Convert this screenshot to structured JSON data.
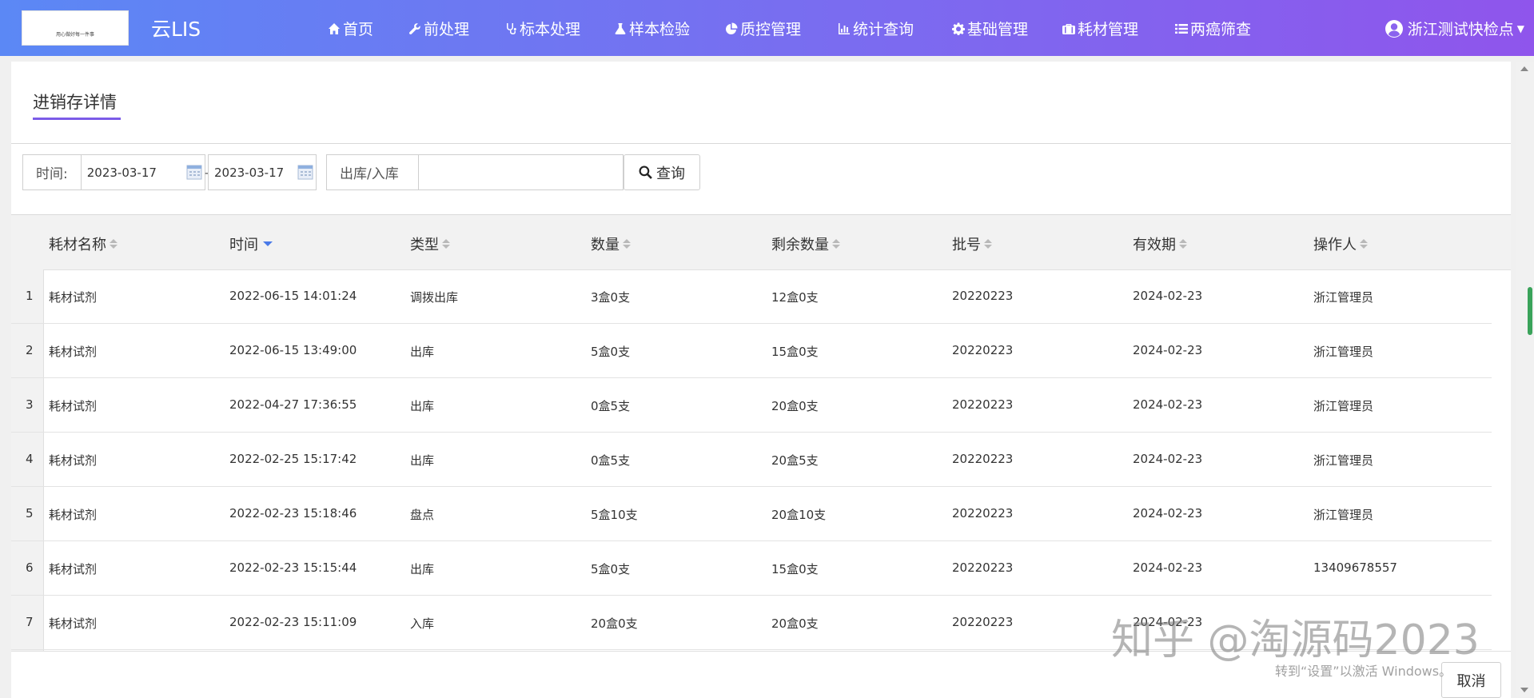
{
  "navbar": {
    "logo_text": "用心做好每一件事",
    "app_title": "云LIS",
    "items": [
      {
        "label": "首页",
        "icon": "home-icon"
      },
      {
        "label": "前处理",
        "icon": "wrench-icon"
      },
      {
        "label": "标本处理",
        "icon": "stethoscope-icon"
      },
      {
        "label": "样本检验",
        "icon": "flask-icon"
      },
      {
        "label": "质控管理",
        "icon": "pie-chart-icon"
      },
      {
        "label": "统计查询",
        "icon": "bar-chart-icon"
      },
      {
        "label": "基础管理",
        "icon": "gear-icon"
      },
      {
        "label": "耗材管理",
        "icon": "briefcase-icon"
      },
      {
        "label": "两癌筛查",
        "icon": "list-icon"
      }
    ],
    "user": "浙江测试快检点"
  },
  "page": {
    "title": "进销存详情"
  },
  "filters": {
    "time_label": "时间:",
    "date_from": "2023-03-17",
    "date_separator": "-",
    "date_to": "2023-03-17",
    "type_label": "出库/入库",
    "type_value": "",
    "query_button": "查询"
  },
  "table": {
    "columns": [
      "耗材名称",
      "时间",
      "类型",
      "数量",
      "剩余数量",
      "批号",
      "有效期",
      "操作人"
    ],
    "rows": [
      {
        "no": "1",
        "name": "耗材试剂",
        "time": "2022-06-15 14:01:24",
        "type": "调拨出库",
        "qty": "3盒0支",
        "remain": "12盒0支",
        "batch": "20220223",
        "expiry": "2024-02-23",
        "operator": "浙江管理员"
      },
      {
        "no": "2",
        "name": "耗材试剂",
        "time": "2022-06-15 13:49:00",
        "type": "出库",
        "qty": "5盒0支",
        "remain": "15盒0支",
        "batch": "20220223",
        "expiry": "2024-02-23",
        "operator": "浙江管理员"
      },
      {
        "no": "3",
        "name": "耗材试剂",
        "time": "2022-04-27 17:36:55",
        "type": "出库",
        "qty": "0盒5支",
        "remain": "20盒0支",
        "batch": "20220223",
        "expiry": "2024-02-23",
        "operator": "浙江管理员"
      },
      {
        "no": "4",
        "name": "耗材试剂",
        "time": "2022-02-25 15:17:42",
        "type": "出库",
        "qty": "0盒5支",
        "remain": "20盒5支",
        "batch": "20220223",
        "expiry": "2024-02-23",
        "operator": "浙江管理员"
      },
      {
        "no": "5",
        "name": "耗材试剂",
        "time": "2022-02-23 15:18:46",
        "type": "盘点",
        "qty": "5盒10支",
        "remain": "20盒10支",
        "batch": "20220223",
        "expiry": "2024-02-23",
        "operator": "浙江管理员"
      },
      {
        "no": "6",
        "name": "耗材试剂",
        "time": "2022-02-23 15:15:44",
        "type": "出库",
        "qty": "5盒0支",
        "remain": "15盒0支",
        "batch": "20220223",
        "expiry": "2024-02-23",
        "operator": "13409678557"
      },
      {
        "no": "7",
        "name": "耗材试剂",
        "time": "2022-02-23 15:11:09",
        "type": "入库",
        "qty": "20盒0支",
        "remain": "20盒0支",
        "batch": "20220223",
        "expiry": "2024-02-23",
        "operator": ""
      }
    ]
  },
  "footer": {
    "cancel_button": "取消"
  },
  "watermark": {
    "zhihu": "知乎 @淘源码2023",
    "windows": "转到“设置”以激活 Windows。"
  },
  "colors": {
    "nav_gradient_start": "#5b88f5",
    "nav_gradient_end": "#8f55ec",
    "title_underline": "#7b5be8",
    "sort_active": "#4a7ae8",
    "scroll_thumb": "#3aa35a"
  }
}
